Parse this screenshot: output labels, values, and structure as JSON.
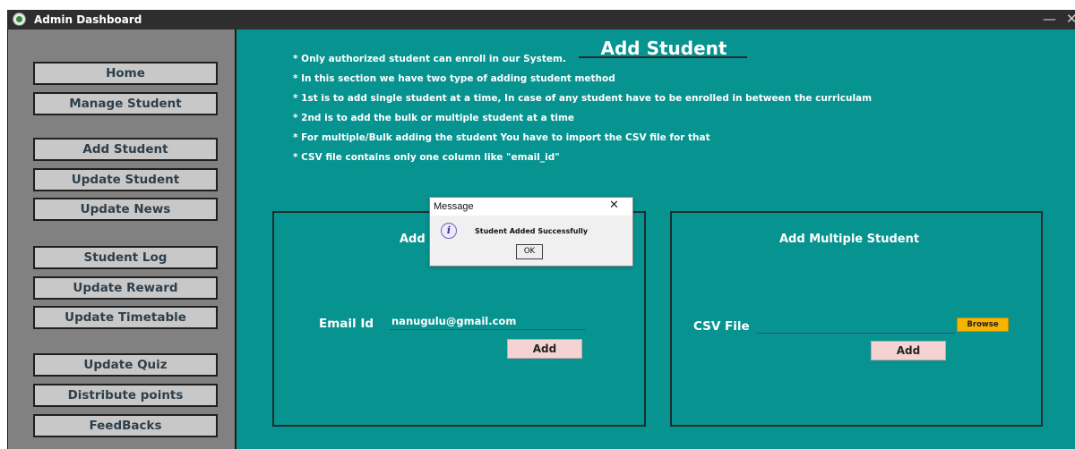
{
  "window": {
    "title": "Admin Dashboard",
    "minimize_glyph": "—",
    "close_glyph": "✕"
  },
  "sidebar": {
    "items": [
      {
        "label": "Home"
      },
      {
        "label": "Manage Student"
      },
      {
        "label": "Add Student"
      },
      {
        "label": "Update Student"
      },
      {
        "label": "Update News"
      },
      {
        "label": "Student Log"
      },
      {
        "label": "Update Reward"
      },
      {
        "label": "Update Timetable"
      },
      {
        "label": "Update Quiz"
      },
      {
        "label": "Distribute points"
      },
      {
        "label": "FeedBacks"
      }
    ]
  },
  "main": {
    "title": "Add Student",
    "info_lines": [
      "* Only authorized student can enroll in our System.",
      "* In this section we have two type of adding student method",
      "* 1st is to add single student at a time, In case of any student have to be enrolled in between the curriculam",
      "* 2nd is to add the bulk or multiple student at a time",
      "* For multiple/Bulk adding the student You have to import the CSV file for that",
      "* CSV file contains only one column like \"email_id\""
    ],
    "single_panel": {
      "title": "Add",
      "email_label": "Email Id",
      "email_value": "nanugulu@gmail.com",
      "add_label": "Add"
    },
    "multiple_panel": {
      "title": "Add Multiple Student",
      "csv_label": "CSV File",
      "csv_value": "",
      "browse_label": "Browse",
      "add_label": "Add"
    }
  },
  "dialog": {
    "title": "Message",
    "close_glyph": "✕",
    "icon_glyph": "i",
    "message": "Student Added Successfully",
    "ok_label": "OK"
  },
  "colors": {
    "main_bg": "#079491",
    "sidebar_bg": "#818181",
    "titlebar_bg": "#2e2e2e",
    "nav_button_bg": "#c8c8c8",
    "add_button_bg": "#f4d3d2",
    "browse_button_bg": "#f6b400"
  }
}
